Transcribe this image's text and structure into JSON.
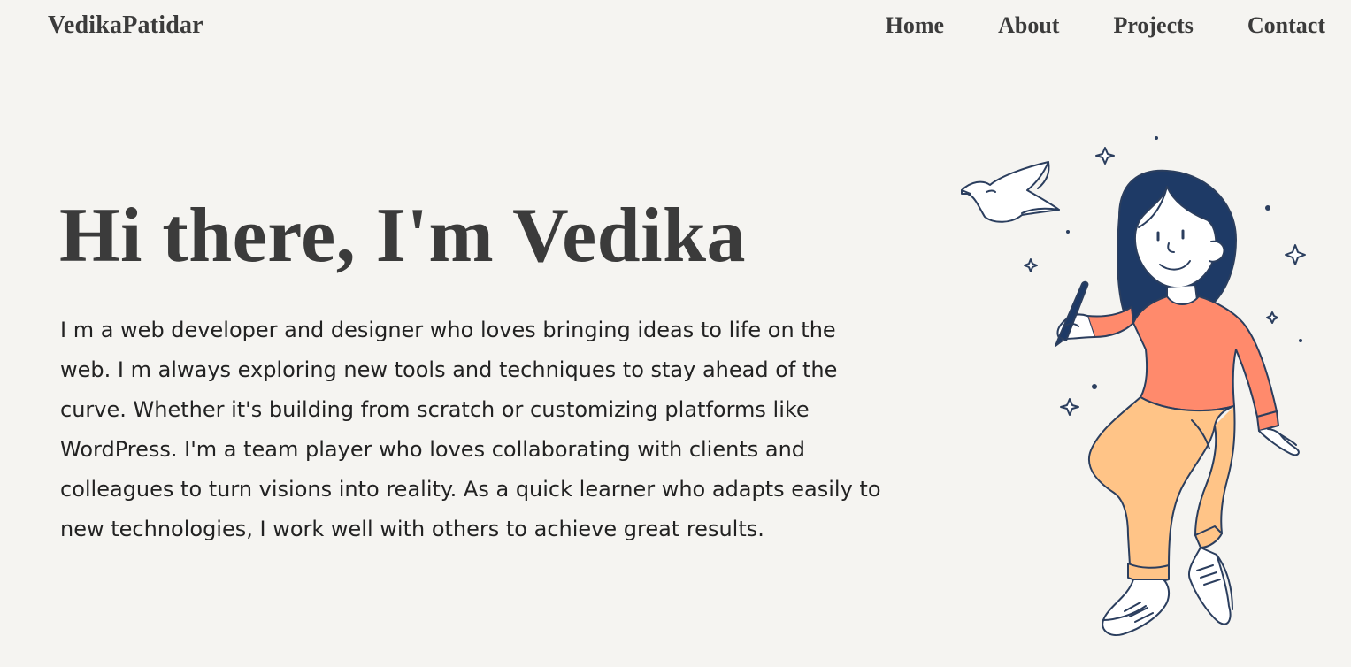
{
  "header": {
    "brand": "VedikaPatidar",
    "nav": [
      {
        "label": "Home"
      },
      {
        "label": "About"
      },
      {
        "label": "Projects"
      },
      {
        "label": "Contact"
      }
    ]
  },
  "hero": {
    "title": "Hi there, I'm Vedika",
    "description": "I m a web developer and designer who loves bringing ideas to life on the web. I m always exploring new tools and techniques to stay ahead of the curve. Whether it's building from scratch or customizing platforms like WordPress. I'm a team player who loves collaborating with clients and colleagues to turn visions into reality. As a quick learner who adapts easily to new technologies, I work well with others to achieve great results."
  },
  "colors": {
    "background": "#f5f4f1",
    "text": "#3b3b3b",
    "hair": "#1e3a66",
    "shirt": "#ff8a6c",
    "pants": "#ffc487",
    "outline": "#2b3e5e"
  }
}
